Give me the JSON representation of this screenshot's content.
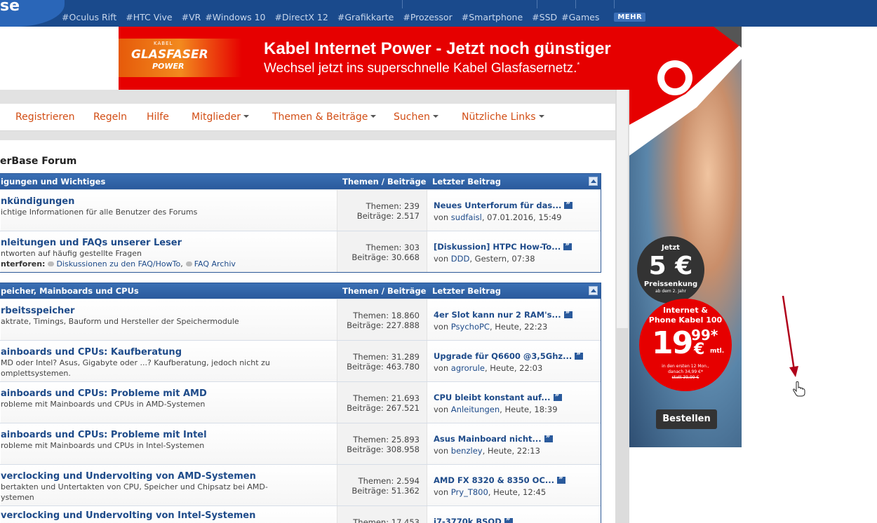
{
  "header": {
    "logo_text": "se",
    "tags": [
      "Oculus Rift",
      "HTC Vive",
      "VR",
      "Windows 10",
      "DirectX 12",
      "Grafikkarte",
      "Prozessor",
      "Smartphone",
      "SSD",
      "Games"
    ],
    "hash": "#",
    "more_label": "MEHR"
  },
  "banner": {
    "logo_small": "KABEL",
    "logo_main": "GLASFASER",
    "logo_sub": "POWER",
    "headline": "Kabel Internet Power - Jetzt noch günstiger",
    "subline": "Wechsel jetzt ins superschnelle Kabel Glasfasernetz.",
    "subline_mark": "*"
  },
  "side_ad": {
    "disc1_l1": "Jetzt",
    "disc1_l2": "5 €",
    "disc1_l3": "Preissenkung",
    "disc1_l4": "ab dem 2. Jahr",
    "disc2_l1": "Internet &",
    "disc2_l2": "Phone Kabel 100",
    "price_main": "19",
    "price_cents": "99*",
    "price_euro": "€",
    "price_mtl": "mtl.",
    "fine1": "in den ersten 12 Mon.,",
    "fine2": "danach 34,99 €*",
    "fine3": "statt 39,99 €",
    "button": "Bestellen"
  },
  "nav": {
    "items": [
      {
        "label": "Registrieren",
        "dropdown": false
      },
      {
        "label": "Regeln",
        "dropdown": false
      },
      {
        "label": "Hilfe",
        "dropdown": false
      },
      {
        "label": "Mitglieder",
        "dropdown": true
      },
      {
        "label": "Themen & Beiträge",
        "dropdown": true
      },
      {
        "label": "Suchen",
        "dropdown": true
      },
      {
        "label": "Nützliche Links",
        "dropdown": true
      }
    ]
  },
  "forum": {
    "title": "erBase Forum",
    "col_threads": "Themen / Beiträge",
    "col_last": "Letzter Beitrag",
    "categories": [
      {
        "name": "igungen und Wichtiges",
        "rows": [
          {
            "title": "nkündigungen",
            "desc": "ichtige Informationen für alle Benutzer des Forums",
            "themen": "Themen: 239",
            "beitraege": "Beiträge: 2.517",
            "last_title": "Neues Unterforum für das...",
            "last_by": "von",
            "last_user": "sudfaisl",
            "last_time": ", 07.01.2016, 15:49"
          },
          {
            "title": "nleitungen und FAQs unserer Leser",
            "desc": "ntworten auf häufig gestellte Fragen",
            "sub_label": "nterforen:",
            "sub1": "Diskussionen zu den FAQ/HowTo",
            "sub_sep": ",",
            "sub2": "FAQ Archiv",
            "themen": "Themen: 303",
            "beitraege": "Beiträge: 30.668",
            "last_title": "[Diskussion] HTPC How-To...",
            "last_by": "von",
            "last_user": "DDD",
            "last_time": ", Gestern, 07:38"
          }
        ]
      },
      {
        "name": "peicher, Mainboards und CPUs",
        "rows": [
          {
            "title": "rbeitsspeicher",
            "desc": "aktrate, Timings, Bauform und Hersteller der Speichermodule",
            "themen": "Themen: 18.860",
            "beitraege": "Beiträge: 227.888",
            "last_title": "4er Slot kann nur 2 RAM's...",
            "last_by": "von",
            "last_user": "PsychoPC",
            "last_time": ", Heute, 22:23"
          },
          {
            "title": "ainboards und CPUs: Kaufberatung",
            "desc": "MD oder Intel? Asus, Gigabyte oder ...? Kaufberatung, jedoch nicht zu omplettsystemen.",
            "themen": "Themen: 31.289",
            "beitraege": "Beiträge: 463.780",
            "last_title": "Upgrade für Q6600 @3,5Ghz...",
            "last_by": "von",
            "last_user": "agrorule",
            "last_time": ", Heute, 22:03"
          },
          {
            "title": "ainboards und CPUs: Probleme mit AMD",
            "desc": "robleme mit Mainboards und CPUs in AMD-Systemen",
            "themen": "Themen: 21.693",
            "beitraege": "Beiträge: 267.521",
            "last_title": "CPU bleibt konstant auf...",
            "last_by": "von",
            "last_user": "Anleitungen",
            "last_time": ", Heute, 18:39"
          },
          {
            "title": "ainboards und CPUs: Probleme mit Intel",
            "desc": "robleme mit Mainboards und CPUs in Intel-Systemen",
            "themen": "Themen: 25.893",
            "beitraege": "Beiträge: 308.958",
            "last_title": "Asus Mainboard nicht...",
            "last_by": "von",
            "last_user": "benzley",
            "last_time": ", Heute, 22:13"
          },
          {
            "title": "verclocking und Undervolting von AMD-Systemen",
            "desc": "bertakten und Untertakten von CPU, Speicher und Chipsatz bei AMD- ystemen",
            "themen": "Themen: 2.594",
            "beitraege": "Beiträge: 51.362",
            "last_title": "AMD FX 8320 & 8350 OC...",
            "last_by": "von",
            "last_user": "Pry_T800",
            "last_time": ", Heute, 12:45"
          },
          {
            "title": "verclocking und Undervolting von Intel-Systemen",
            "desc": "",
            "themen": "Themen: 17.453",
            "beitraege": "",
            "last_title": "i7-3770k BSOD",
            "last_by": "",
            "last_user": "",
            "last_time": ""
          }
        ]
      }
    ]
  },
  "colors": {
    "brand_blue": "#1a4a8c",
    "nav_orange": "#d24d14",
    "link_blue": "#1e4b8a",
    "ad_red": "#e60000",
    "annotation_red": "#b0001a"
  }
}
